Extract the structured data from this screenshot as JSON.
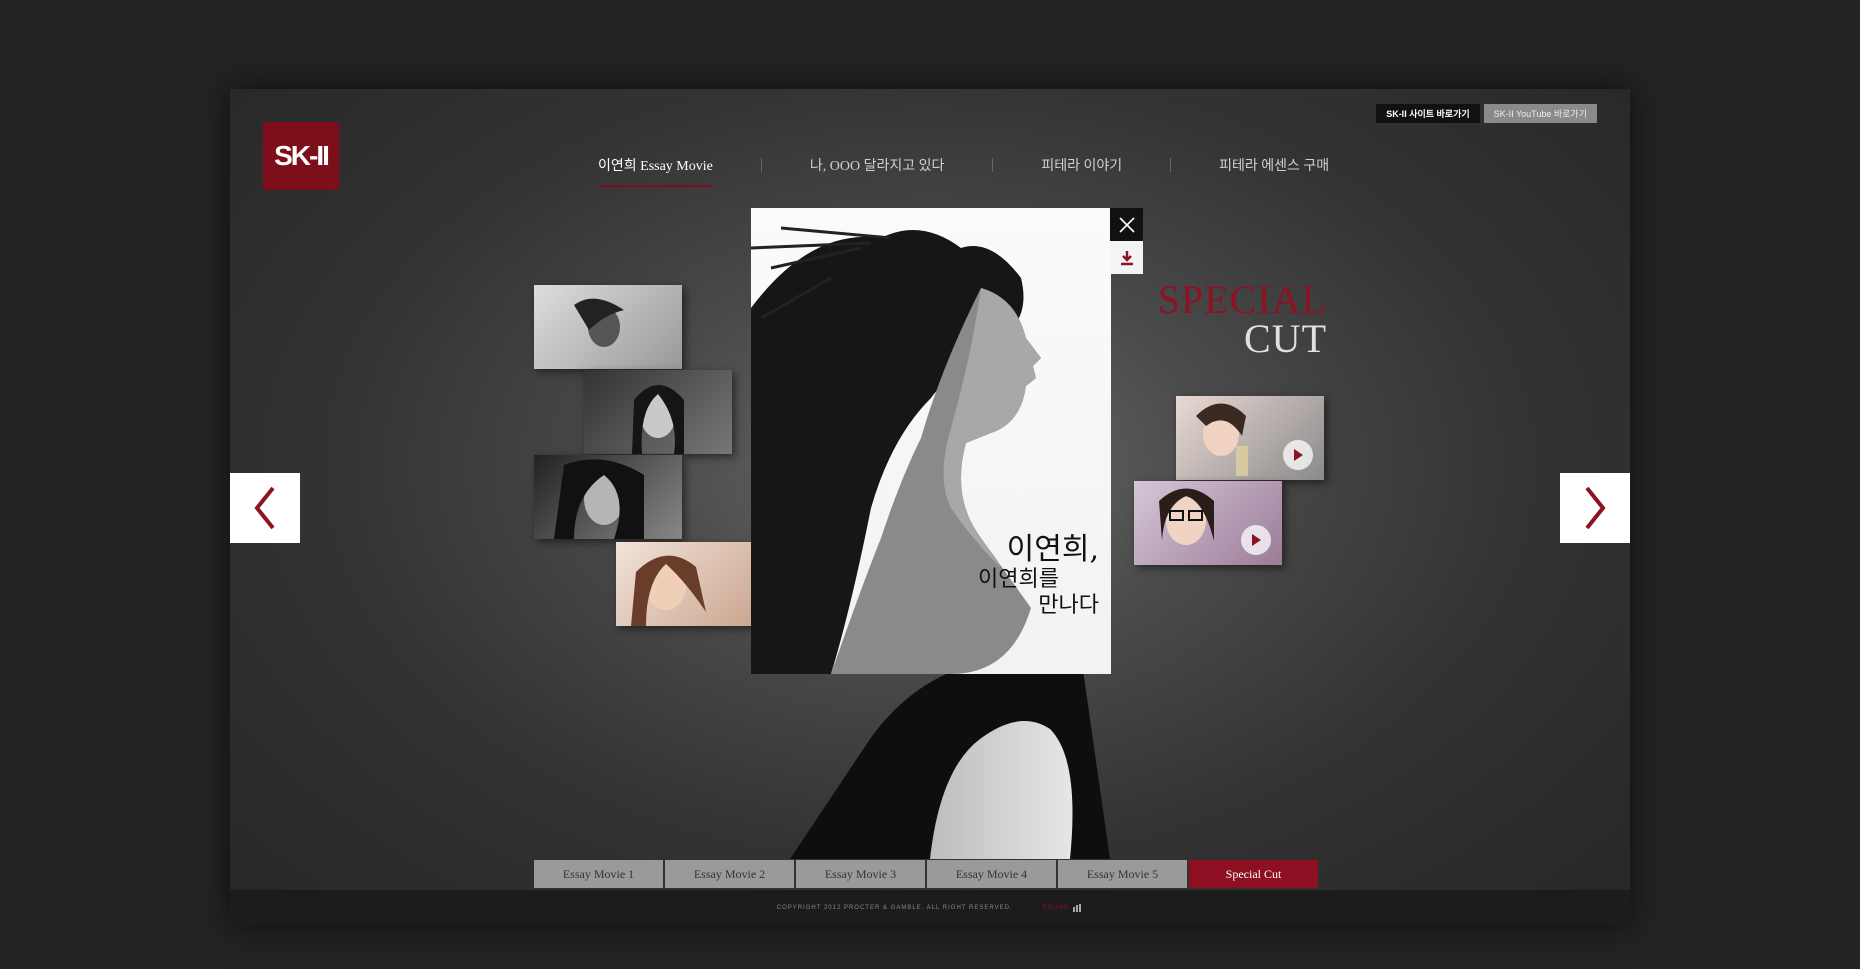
{
  "logo": {
    "text": "SK-II"
  },
  "top_buttons": [
    {
      "label": "SK-II 사이트 바로가기"
    },
    {
      "label": "SK-II YouTube 바로가기"
    }
  ],
  "nav": {
    "items": [
      {
        "label": "이연희 Essay Movie",
        "active": true
      },
      {
        "label": "나, OOO 달라지고 있다",
        "active": false
      },
      {
        "label": "피테라 이야기",
        "active": false
      },
      {
        "label": "피테라 에센스 구매",
        "active": false
      }
    ]
  },
  "poster": {
    "title_line1": "이연희,",
    "title_line2": "이연희를",
    "title_line3": "만나다"
  },
  "special_cut": {
    "line1": "SPECIAL",
    "line2": "CUT"
  },
  "tabs": [
    {
      "label": "Essay Movie 1",
      "active": false
    },
    {
      "label": "Essay Movie 2",
      "active": false
    },
    {
      "label": "Essay Movie 3",
      "active": false
    },
    {
      "label": "Essay Movie 4",
      "active": false
    },
    {
      "label": "Essay Movie 5",
      "active": false
    },
    {
      "label": "Special Cut",
      "active": true
    }
  ],
  "footer": {
    "copyright": "COPYRIGHT 2012 PROCTER & GAMBLE. ALL RIGHT RESERVED.",
    "sound_label": "SOUND"
  },
  "colors": {
    "brand": "#7c0f19",
    "accent": "#8c1224",
    "background": "#232323"
  }
}
